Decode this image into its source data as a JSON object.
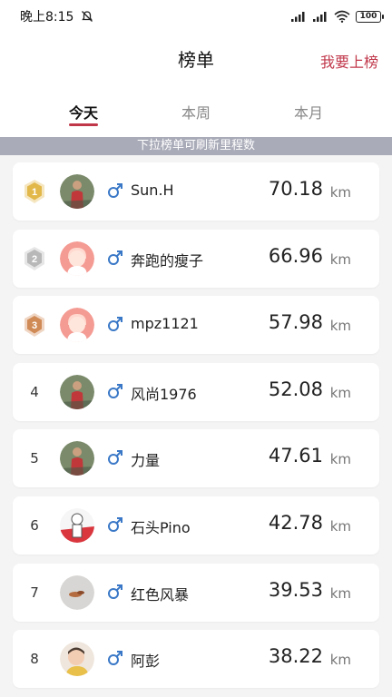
{
  "status_bar": {
    "time": "晚上8:15",
    "battery": "100"
  },
  "header": {
    "title": "榜单",
    "action": "我要上榜"
  },
  "tabs": [
    {
      "label": "今天",
      "active": true
    },
    {
      "label": "本周",
      "active": false
    },
    {
      "label": "本月",
      "active": false
    }
  ],
  "hint": "下拉榜单可刷新里程数",
  "unit": "km",
  "colors": {
    "accent": "#c0374a",
    "male": "#3a78c7",
    "banner": "#a9abb8",
    "gold": "#e2b84a",
    "silver": "#b8b8b8",
    "bronze": "#d08a55"
  },
  "ranking": [
    {
      "rank": "1",
      "medal": "gold",
      "name": "Sun.H",
      "distance": "70.18",
      "avatar": "runner-photo-icon"
    },
    {
      "rank": "2",
      "medal": "silver",
      "name": "奔跑的瘦子",
      "distance": "66.96",
      "avatar": "default-avatar-icon"
    },
    {
      "rank": "3",
      "medal": "bronze",
      "name": "mpz1121",
      "distance": "57.98",
      "avatar": "default-avatar-icon"
    },
    {
      "rank": "4",
      "medal": "",
      "name": "风尚1976",
      "distance": "52.08",
      "avatar": "runner-photo-icon"
    },
    {
      "rank": "5",
      "medal": "",
      "name": "力量",
      "distance": "47.61",
      "avatar": "runner-photo-icon"
    },
    {
      "rank": "6",
      "medal": "",
      "name": "石头Pino",
      "distance": "42.78",
      "avatar": "cartoon-avatar-icon"
    },
    {
      "rank": "7",
      "medal": "",
      "name": "红色风暴",
      "distance": "39.53",
      "avatar": "object-photo-icon"
    },
    {
      "rank": "8",
      "medal": "",
      "name": "阿彭",
      "distance": "38.22",
      "avatar": "child-photo-icon"
    }
  ]
}
